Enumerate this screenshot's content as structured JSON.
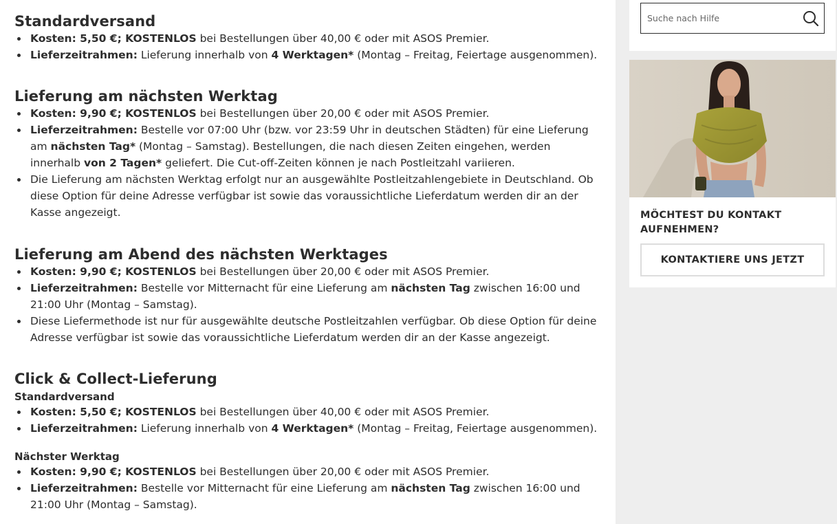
{
  "sections": [
    {
      "title": "Standardversand",
      "items": [
        {
          "b1": "Kosten: 5,50 €; KOSTENLOS",
          "t1": " bei Bestellungen über 40,00 € oder mit ASOS Premier."
        },
        {
          "b1": "Lieferzeitrahmen:",
          "t1": " Lieferung innerhalb von ",
          "b2": "4 Werktagen*",
          "t2": " (Montag – Freitag, Feiertage ausgenommen)."
        }
      ]
    },
    {
      "title": "Lieferung am nächsten Werktag",
      "items": [
        {
          "b1": "Kosten: 9,90 €; KOSTENLOS",
          "t1": " bei Bestellungen über 20,00 € oder mit ASOS Premier."
        },
        {
          "b1": "Lieferzeitrahmen:",
          "t1": " Bestelle vor 07:00 Uhr (bzw. vor 23:59 Uhr in deutschen Städten) für eine Lieferung am ",
          "b2": "nächsten Tag*",
          "t2": " (Montag – Samstag). Bestellungen, die nach diesen Zeiten eingehen, werden innerhalb ",
          "b3": "von 2 Tagen*",
          "t3": " geliefert. Die Cut-off-Zeiten können je nach Postleitzahl variieren."
        },
        {
          "t1": "Die Lieferung am nächsten Werktag erfolgt nur an ausgewählte Postleitzahlengebiete in Deutschland. Ob diese Option für deine Adresse verfügbar ist sowie das voraussichtliche Lieferdatum werden dir an der Kasse angezeigt."
        }
      ]
    },
    {
      "title": "Lieferung am Abend des nächsten Werktages",
      "items": [
        {
          "b1": "Kosten: 9,90 €; KOSTENLOS",
          "t1": " bei Bestellungen über 20,00 € oder mit ASOS Premier."
        },
        {
          "b1": "Lieferzeitrahmen:",
          "t1": " Bestelle vor Mitternacht für eine Lieferung am ",
          "b2": "nächsten Tag",
          "t2": " zwischen 16:00 und 21:00 Uhr (Montag – Samstag)."
        },
        {
          "t1": "Diese Liefermethode ist nur für ausgewählte deutsche Postleitzahlen verfügbar. Ob diese Option für deine Adresse verfügbar ist sowie das voraussichtliche Lieferdatum werden dir an der Kasse angezeigt."
        }
      ]
    }
  ],
  "click_collect": {
    "title": "Click & Collect-Lieferung",
    "standard": {
      "subtitle": "Standardversand",
      "items": [
        {
          "b1": "Kosten: 5,50 €; KOSTENLOS",
          "t1": " bei Bestellungen über 40,00 € oder mit ASOS Premier."
        },
        {
          "b1": "Lieferzeitrahmen:",
          "t1": " Lieferung innerhalb von ",
          "b2": "4 Werktagen*",
          "t2": " (Montag – Freitag, Feiertage ausgenommen)."
        }
      ]
    },
    "next_day": {
      "subtitle": "Nächster Werktag",
      "items": [
        {
          "b1": "Kosten: 9,90 €; KOSTENLOS",
          "t1": " bei Bestellungen über 20,00 € oder mit ASOS Premier."
        },
        {
          "b1": "Lieferzeitrahmen:",
          "t1": " Bestelle vor Mitternacht für eine Lieferung am ",
          "b2": "nächsten Tag",
          "t2": " zwischen 16:00 und 21:00 Uhr (Montag – Samstag)."
        }
      ]
    }
  },
  "sidebar": {
    "search_placeholder": "Suche nach Hilfe",
    "search_icon": "search-icon",
    "contact_title": "MÖCHTEST DU KONTAKT AUFNEHMEN?",
    "contact_button": "KONTAKTIERE UNS JETZT"
  }
}
